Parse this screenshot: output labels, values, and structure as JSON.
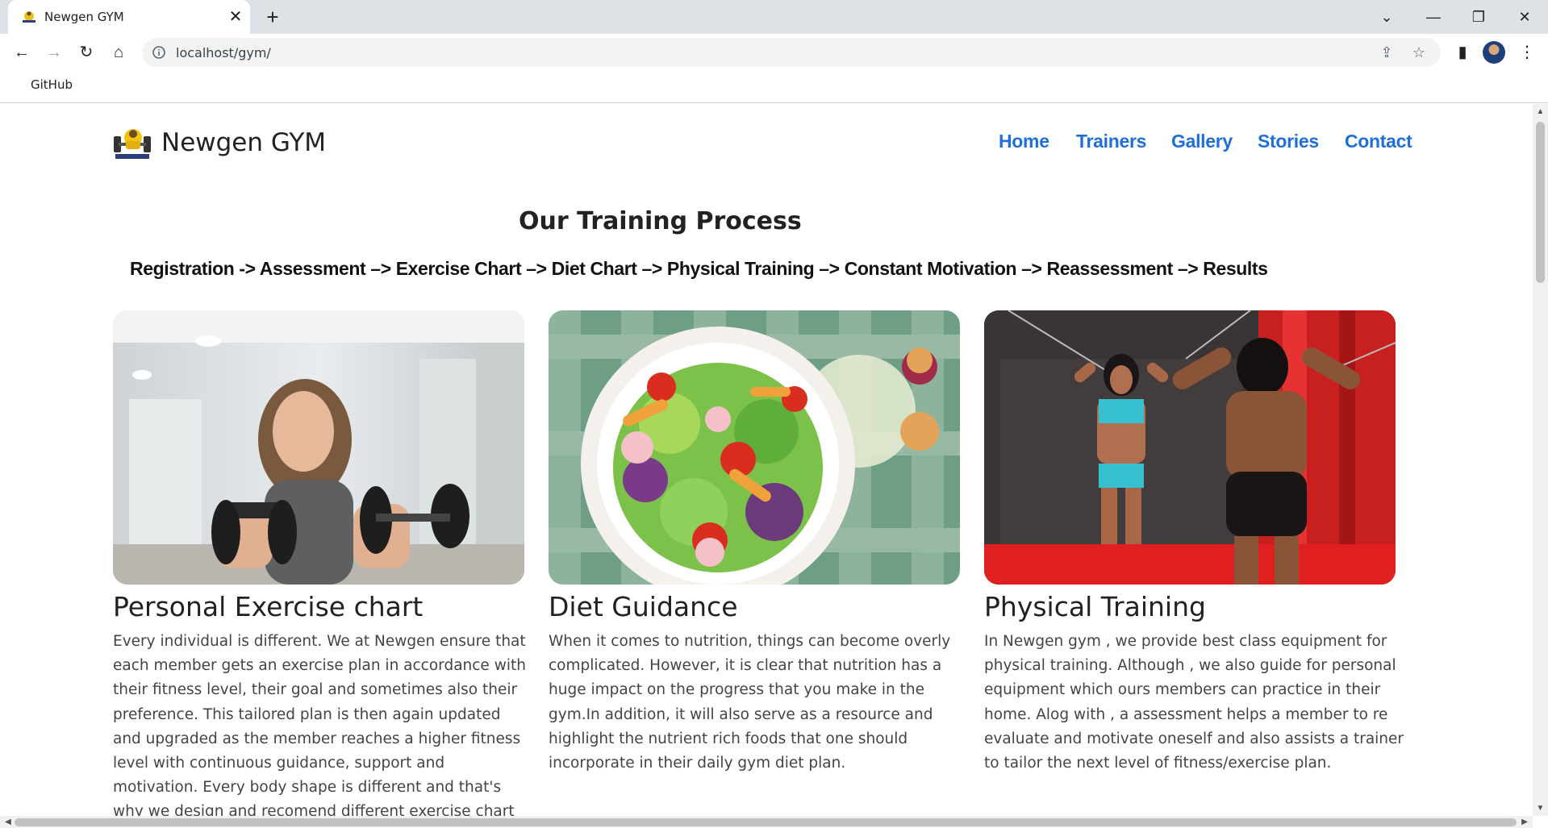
{
  "browser": {
    "tab_title": "Newgen GYM",
    "tab_close": "✕",
    "new_tab": "+",
    "url": "localhost/gym/",
    "bookmark": "GitHub",
    "controls": {
      "back": "←",
      "forward": "→",
      "reload": "↻",
      "home": "⌂",
      "share": "⇪",
      "star": "☆",
      "sidepanel": "▮",
      "menu": "⋮",
      "tab_search": "⌄",
      "minimize": "—",
      "restore": "❐",
      "close": "✕"
    }
  },
  "site": {
    "brand": "Newgen GYM",
    "nav": [
      "Home",
      "Trainers",
      "Gallery",
      "Stories",
      "Contact"
    ],
    "section_title": "Our Training Process",
    "process": "Registration -> Assessment –> Exercise Chart –> Diet Chart –> Physical Training –> Constant Motivation –> Reassessment –> Results",
    "cards": [
      {
        "title": "Personal Exercise chart",
        "text": "Every individual is different. We at Newgen ensure that each member gets an exercise plan in accordance with their fitness level, their goal and sometimes also their preference. This tailored plan is then again updated and upgraded as the member reaches a higher fitness level with continuous guidance, support and motivation. Every body shape is different and that's why we design and recomend different exercise chart for each other.",
        "image": "woman-lifting-dumbbells-photo"
      },
      {
        "title": "Diet Guidance",
        "text": "When it comes to nutrition, things can become overly complicated. However, it is clear that nutrition has a huge impact on the progress that you make in the gym.In addition, it will also serve as a resource and highlight the nutrient rich foods that one should incorporate in their daily gym diet plan.",
        "image": "salad-bowl-photo"
      },
      {
        "title": "Physical Training",
        "text": "In Newgen gym , we provide best class equipment for physical training. Although , we also guide for personal equipment which ours members can practice in their home. Alog with , a assessment helps a member to re evaluate and motivate oneself and also assists a trainer to tailor the next level of fitness/exercise plan.",
        "image": "cable-training-mirror-photo"
      }
    ]
  },
  "colors": {
    "nav": "#1e6fd9",
    "tabstrip": "#dee1e6"
  }
}
